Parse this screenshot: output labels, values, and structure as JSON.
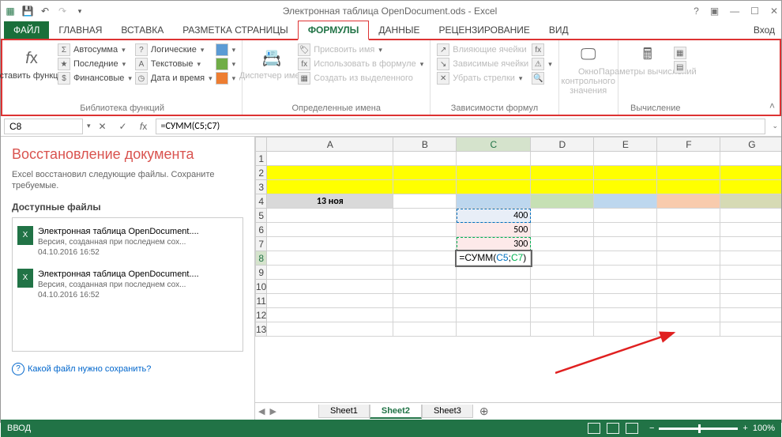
{
  "title": "Электронная таблица OpenDocument.ods - Excel",
  "signin": "Вход",
  "tabs": {
    "file": "ФАЙЛ",
    "home": "ГЛАВНАЯ",
    "insert": "ВСТАВКА",
    "page": "РАЗМЕТКА СТРАНИЦЫ",
    "formulas": "ФОРМУЛЫ",
    "data": "ДАННЫЕ",
    "review": "РЕЦЕНЗИРОВАНИЕ",
    "view": "ВИД"
  },
  "ribbon": {
    "insert_fn": "Вставить функцию",
    "lib": {
      "autosum": "Автосумма",
      "recent": "Последние",
      "financial": "Финансовые",
      "logical": "Логические",
      "text": "Текстовые",
      "datetime": "Дата и время",
      "label": "Библиотека функций"
    },
    "names": {
      "mgr": "Диспетчер имен",
      "define": "Присвоить имя",
      "use": "Использовать в формуле",
      "create": "Создать из выделенного",
      "label": "Определенные имена"
    },
    "audit": {
      "precedents": "Влияющие ячейки",
      "dependents": "Зависимые ячейки",
      "remove": "Убрать стрелки",
      "label": "Зависимости формул"
    },
    "watch": "Окно контрольного значения",
    "calc": {
      "options": "Параметры вычислений",
      "label": "Вычисление"
    }
  },
  "namebox": "C8",
  "formula": "=СУММ(C5;C7)",
  "recovery": {
    "title": "Восстановление документа",
    "desc": "Excel восстановил следующие файлы. Сохраните требуемые.",
    "available": "Доступные файлы",
    "files": [
      {
        "name": "Электронная таблица OpenDocument....",
        "ver": "Версия, созданная при последнем сох...",
        "date": "04.10.2016 16:52"
      },
      {
        "name": "Электронная таблица OpenDocument....",
        "ver": "Версия, созданная при последнем сох...",
        "date": "04.10.2016 16:52"
      }
    ],
    "help": "Какой файл нужно сохранить?"
  },
  "sheet": {
    "cols": [
      "A",
      "B",
      "C",
      "D",
      "E",
      "F",
      "G"
    ],
    "a4": "13 ноя",
    "c5": "400",
    "c6": "500",
    "c7": "300",
    "c8_fn": "=СУММ(",
    "c8_r1": "C5",
    "c8_sep": ";",
    "c8_r2": "C7",
    "c8_end": ")",
    "tabs": [
      "Sheet1",
      "Sheet2",
      "Sheet3"
    ]
  },
  "status": {
    "mode": "ВВОД",
    "zoom": "100%"
  }
}
